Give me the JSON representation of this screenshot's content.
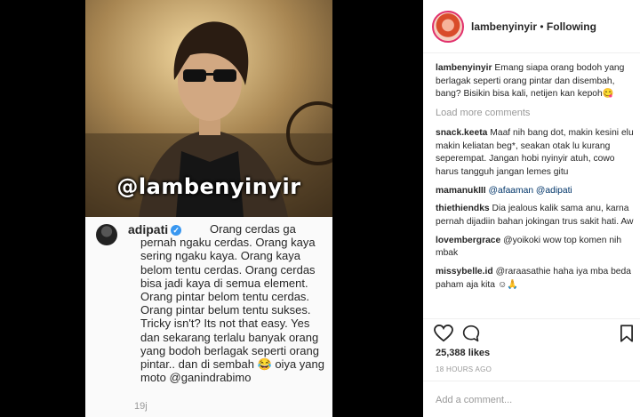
{
  "post": {
    "image_watermark": "@lambenyinyir",
    "quoted_comment": {
      "author": "adipati",
      "verified_icon": "verified-check-icon",
      "text": "Orang cerdas ga pernah ngaku cerdas. Orang kaya sering ngaku kaya. Orang kaya belom tentu cerdas. Orang cerdas bisa jadi kaya di semua element. Orang pintar belom tentu cerdas. Orang pintar belum tentu sukses. Tricky isn't? Its not that easy. Yes dan sekarang terlalu banyak orang yang bodoh berlagak seperti orang pintar.. dan di sembah 😂 oiya yang moto @ganindrabimo",
      "time": "19j"
    }
  },
  "header": {
    "username": "lambenyinyir",
    "separator": "•",
    "follow_status": "Following"
  },
  "caption": {
    "username": "lambenyinyir",
    "text": "Emang siapa orang bodoh yang berlagak seperti orang pintar dan disembah, bang? Bisikin bisa kali, netijen kan kepoh😋"
  },
  "load_more": "Load more comments",
  "comments": [
    {
      "username": "snack.keeta",
      "text": "Maaf nih bang dot, makin kesini elu makin keliatan beg*, seakan otak lu kurang seperempat. Jangan hobi nyinyir atuh, cowo harus tangguh jangan lemes gitu"
    },
    {
      "username": "mamanukIII",
      "text": "@afaaman @adipati"
    },
    {
      "username": "thiethiendks",
      "text": "Dia jealous kalik sama anu, karna pernah dijadiin bahan jokingan trus sakit hati. Aw"
    },
    {
      "username": "lovembergrace",
      "text": "@yoikoki wow top komen nih mbak"
    },
    {
      "username": "missybelle.id",
      "text": "@raraasathie haha iya mba beda paham aja kita ☺🙏"
    }
  ],
  "actions": {
    "like_icon": "heart-icon",
    "comment_icon": "comment-bubble-icon",
    "save_icon": "bookmark-icon",
    "likes": "25,388 likes",
    "time_ago": "18 HOURS AGO"
  },
  "add_comment": {
    "placeholder": "Add a comment..."
  },
  "colors": {
    "background": "#000000",
    "panel": "#ffffff",
    "link": "#003569",
    "muted": "#999999",
    "verified": "#3897f0"
  }
}
